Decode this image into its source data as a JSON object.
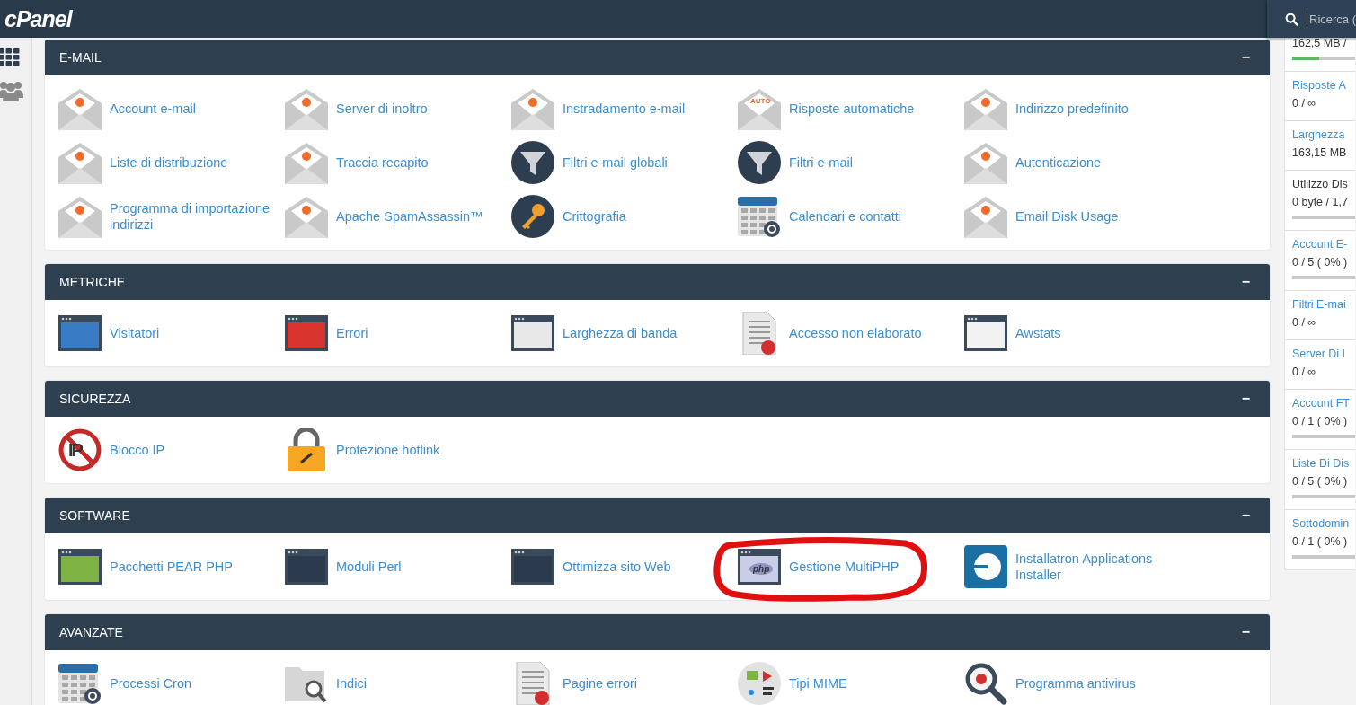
{
  "topbar": {
    "logo": "cPanel",
    "search": {
      "placeholder": "Ricerca ("
    }
  },
  "sections": [
    {
      "title": "E-MAIL",
      "toggle": "−",
      "items": [
        {
          "label": "Account e-mail",
          "kind": "envelope"
        },
        {
          "label": "Server di inoltro",
          "kind": "envelope"
        },
        {
          "label": "Instradamento e-mail",
          "kind": "envelope"
        },
        {
          "label": "Risposte automatiche",
          "kind": "envelope",
          "badge": "AUTO"
        },
        {
          "label": "Indirizzo predefinito",
          "kind": "envelope"
        },
        {
          "label": "Liste di distribuzione",
          "kind": "envelope"
        },
        {
          "label": "Traccia recapito",
          "kind": "envelope"
        },
        {
          "label": "Filtri e-mail globali",
          "kind": "funnel"
        },
        {
          "label": "Filtri e-mail",
          "kind": "funnel"
        },
        {
          "label": "Autenticazione",
          "kind": "envelope"
        },
        {
          "label": "Programma di importazione indirizzi",
          "kind": "envelope"
        },
        {
          "label": "Apache SpamAssassin™",
          "kind": "envelope"
        },
        {
          "label": "Crittografia",
          "kind": "key"
        },
        {
          "label": "Calendari e contatti",
          "kind": "calendar"
        },
        {
          "label": "Email Disk Usage",
          "kind": "envelope"
        }
      ]
    },
    {
      "title": "METRICHE",
      "toggle": "−",
      "items": [
        {
          "label": "Visitatori",
          "kind": "window",
          "color": "#3a7cc4"
        },
        {
          "label": "Errori",
          "kind": "window",
          "color": "#d9342b"
        },
        {
          "label": "Larghezza di banda",
          "kind": "window",
          "color": "#e8e8e8"
        },
        {
          "label": "Accesso non elaborato",
          "kind": "document"
        },
        {
          "label": "Awstats",
          "kind": "window",
          "color": "#f2f2f2"
        }
      ]
    },
    {
      "title": "SICUREZZA",
      "toggle": "−",
      "items": [
        {
          "label": "Blocco IP",
          "kind": "prohibited",
          "badge": "IP"
        },
        {
          "label": "Protezione hotlink",
          "kind": "padlock"
        }
      ]
    },
    {
      "title": "SOFTWARE",
      "toggle": "−",
      "items": [
        {
          "label": "Pacchetti PEAR PHP",
          "kind": "window",
          "color": "#7cb342"
        },
        {
          "label": "Moduli Perl",
          "kind": "window",
          "color": "#2b3a4c"
        },
        {
          "label": "Ottimizza sito Web",
          "kind": "window",
          "color": "#2b3a4c"
        },
        {
          "label": "Gestione MultiPHP",
          "kind": "window",
          "color": "#c9cde8",
          "badge": "php",
          "highlighted": true
        },
        {
          "label": "Installatron Applications Installer",
          "kind": "app"
        }
      ]
    },
    {
      "title": "AVANZATE",
      "toggle": "−",
      "items": [
        {
          "label": "Processi Cron",
          "kind": "calendar"
        },
        {
          "label": "Indici",
          "kind": "folder"
        },
        {
          "label": "Pagine errori",
          "kind": "document"
        },
        {
          "label": "Tipi MIME",
          "kind": "media"
        },
        {
          "label": "Programma antivirus",
          "kind": "magnifier"
        }
      ]
    }
  ],
  "stats": [
    {
      "kind": "meter",
      "value": "162,5 MB /",
      "level": 0.43
    },
    {
      "kind": "count",
      "label": "Risposte A",
      "link": true,
      "value": "0 / ∞"
    },
    {
      "kind": "count",
      "label": "Larghezza",
      "link": true,
      "value": "163,15 MB"
    },
    {
      "kind": "meter",
      "label": "Utilizzo Dis",
      "link": false,
      "value": "0 byte / 1,7"
    },
    {
      "kind": "meter",
      "label": "Account E-",
      "link": true,
      "value": "0 / 5 ( 0% )"
    },
    {
      "kind": "count",
      "label": "Filtri E-mai",
      "link": true,
      "value": "0 / ∞"
    },
    {
      "kind": "count",
      "label": "Server Di I",
      "link": true,
      "value": "0 / ∞"
    },
    {
      "kind": "meter",
      "label": "Account FT",
      "link": true,
      "value": "0 / 1 ( 0% )"
    },
    {
      "kind": "meter",
      "label": "Liste Di Dis",
      "link": true,
      "value": "0 / 5 ( 0% )"
    },
    {
      "kind": "meter",
      "label": "Sottodomin",
      "link": true,
      "value": "0 / 1 ( 0% )"
    }
  ]
}
